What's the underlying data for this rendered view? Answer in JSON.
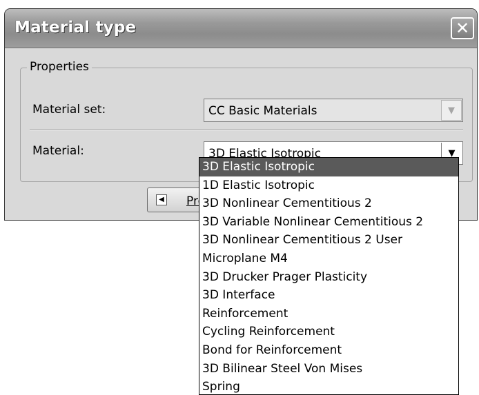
{
  "window": {
    "title": "Material type",
    "close_glyph": "✕"
  },
  "properties": {
    "group_label": "Properties",
    "material_set_label": "Material set:",
    "material_set_value": "CC Basic Materials",
    "material_label": "Material:",
    "material_value": "3D Elastic Isotropic"
  },
  "buttons": {
    "prev_label": "Pre",
    "prev_icon": "arrow-left-icon"
  },
  "dropdown": {
    "selected_index": 0,
    "items": [
      "3D Elastic Isotropic",
      "1D Elastic Isotropic",
      "3D Nonlinear Cementitious 2",
      "3D Variable Nonlinear Cementitious 2",
      "3D Nonlinear Cementitious 2 User",
      "Microplane M4",
      "3D Drucker Prager Plasticity",
      "3D Interface",
      "Reinforcement",
      "Cycling Reinforcement",
      "Bond for Reinforcement",
      "3D Bilinear Steel Von Mises",
      "Spring"
    ]
  },
  "colors": {
    "selection_background": "#5a5a5a",
    "dialog_background": "#d9d9d9"
  }
}
